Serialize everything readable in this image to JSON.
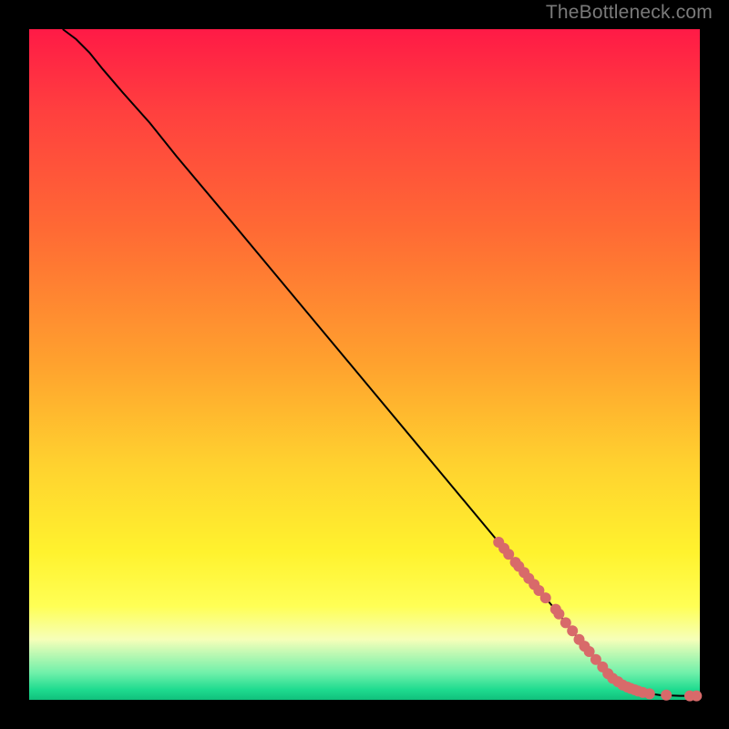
{
  "attribution": "TheBottleneck.com",
  "palette": {
    "page_bg": "#000000",
    "point_color": "#d86a6a",
    "curve_color": "#000000",
    "gradient_stops": [
      {
        "pos": 0.0,
        "color": "#ff1a46"
      },
      {
        "pos": 0.12,
        "color": "#ff3f3f"
      },
      {
        "pos": 0.3,
        "color": "#ff6a34"
      },
      {
        "pos": 0.5,
        "color": "#ffa22e"
      },
      {
        "pos": 0.65,
        "color": "#ffd22f"
      },
      {
        "pos": 0.78,
        "color": "#fff22e"
      },
      {
        "pos": 0.86,
        "color": "#ffff55"
      },
      {
        "pos": 0.91,
        "color": "#f6ffb9"
      },
      {
        "pos": 0.96,
        "color": "#6ff0aa"
      },
      {
        "pos": 0.985,
        "color": "#1edb8f"
      },
      {
        "pos": 1.0,
        "color": "#11c07c"
      }
    ]
  },
  "chart_data": {
    "type": "line",
    "title": "",
    "xlabel": "",
    "ylabel": "",
    "xlim": [
      0,
      100
    ],
    "ylim": [
      0,
      100
    ],
    "series": [
      {
        "name": "curve",
        "x": [
          5,
          7,
          9,
          11,
          14,
          18,
          22,
          30,
          40,
          50,
          60,
          70,
          78,
          84,
          86,
          88,
          90,
          92,
          94,
          97,
          100
        ],
        "y": [
          100,
          98.5,
          96.5,
          94,
          90.5,
          86,
          81,
          71.5,
          59.5,
          47.5,
          35.5,
          23.5,
          14,
          6.5,
          4.2,
          2.6,
          1.6,
          1.0,
          0.7,
          0.6,
          0.6
        ]
      }
    ],
    "points": [
      {
        "name": "p1",
        "x": 70.0,
        "y": 23.5
      },
      {
        "name": "p2",
        "x": 70.8,
        "y": 22.6
      },
      {
        "name": "p3",
        "x": 71.5,
        "y": 21.7
      },
      {
        "name": "p4",
        "x": 72.5,
        "y": 20.5
      },
      {
        "name": "p5",
        "x": 73.0,
        "y": 19.9
      },
      {
        "name": "p6",
        "x": 73.8,
        "y": 19.0
      },
      {
        "name": "p7",
        "x": 74.5,
        "y": 18.1
      },
      {
        "name": "p8",
        "x": 75.3,
        "y": 17.2
      },
      {
        "name": "p9",
        "x": 76.0,
        "y": 16.3
      },
      {
        "name": "p10",
        "x": 77.0,
        "y": 15.2
      },
      {
        "name": "p11",
        "x": 78.5,
        "y": 13.5
      },
      {
        "name": "p12",
        "x": 79.0,
        "y": 12.8
      },
      {
        "name": "p13",
        "x": 80.0,
        "y": 11.5
      },
      {
        "name": "p14",
        "x": 81.0,
        "y": 10.3
      },
      {
        "name": "p15",
        "x": 82.0,
        "y": 9.0
      },
      {
        "name": "p16",
        "x": 82.8,
        "y": 8.0
      },
      {
        "name": "p17",
        "x": 83.5,
        "y": 7.2
      },
      {
        "name": "p18",
        "x": 84.5,
        "y": 6.0
      },
      {
        "name": "p19",
        "x": 85.5,
        "y": 4.9
      },
      {
        "name": "p20",
        "x": 86.3,
        "y": 3.9
      },
      {
        "name": "p21",
        "x": 87.0,
        "y": 3.2
      },
      {
        "name": "p22",
        "x": 87.8,
        "y": 2.7
      },
      {
        "name": "p23",
        "x": 88.5,
        "y": 2.2
      },
      {
        "name": "p24",
        "x": 89.2,
        "y": 1.9
      },
      {
        "name": "p25",
        "x": 89.7,
        "y": 1.7
      },
      {
        "name": "p26",
        "x": 90.3,
        "y": 1.5
      },
      {
        "name": "p27",
        "x": 90.8,
        "y": 1.3
      },
      {
        "name": "p28",
        "x": 91.5,
        "y": 1.1
      },
      {
        "name": "p29",
        "x": 92.5,
        "y": 0.9
      },
      {
        "name": "p30",
        "x": 95.0,
        "y": 0.7
      },
      {
        "name": "p31",
        "x": 98.5,
        "y": 0.6
      },
      {
        "name": "p32",
        "x": 99.5,
        "y": 0.6
      }
    ],
    "point_radius": 6
  }
}
